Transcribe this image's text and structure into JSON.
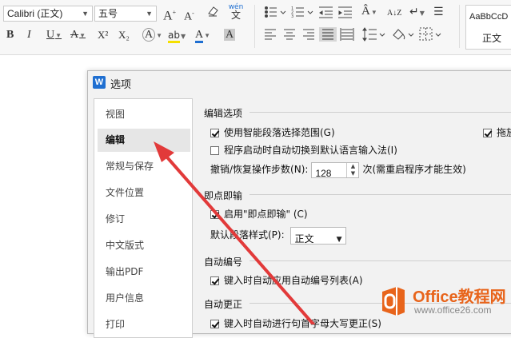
{
  "ribbon": {
    "font_name": "Calibri (正文)",
    "font_size": "五号",
    "style_sample": "AaBbCcD",
    "style_name": "正文",
    "grow_font_glyph": "A",
    "shrink_font_glyph": "A",
    "pinyin_glyph": "wén",
    "bold_glyph": "B",
    "italic_glyph": "I",
    "underline_glyph": "U",
    "strike_glyph": "A",
    "superscript_glyph": "X²",
    "subscript_glyph": "X₂",
    "text_effect_glyph": "A",
    "highlight_glyph": "ab",
    "font_color_glyph": "A",
    "char_shading_glyph": "A",
    "accent_color": "#1f6fd1"
  },
  "dialog": {
    "title": "选项",
    "app_icon_letter": "W",
    "nav_items": [
      {
        "label": "视图"
      },
      {
        "label": "编辑"
      },
      {
        "label": "常规与保存"
      },
      {
        "label": "文件位置"
      },
      {
        "label": "修订"
      },
      {
        "label": "中文版式"
      },
      {
        "label": "输出PDF"
      },
      {
        "label": "用户信息"
      },
      {
        "label": "打印"
      }
    ],
    "active_nav": "编辑",
    "sections": {
      "edit_options": {
        "title": "编辑选项",
        "smart_paragraph": {
          "label": "使用智能段落选择范围(G)",
          "checked": true
        },
        "drag_text": {
          "label": "拖放",
          "checked": true
        },
        "auto_ime": {
          "label": "程序启动时自动切换到默认语言输入法(I)",
          "checked": false
        },
        "undo_label": "撤销/恢复操作步数(N):",
        "undo_value": "128",
        "undo_suffix": "次(需重启程序才能生效)"
      },
      "click_and_type": {
        "title": "即点即输",
        "enable": {
          "label": "启用\"即点即输\" (C)",
          "checked": true
        },
        "default_style_label": "默认段落样式(P):",
        "default_style_value": "正文"
      },
      "auto_numbering": {
        "title": "自动编号",
        "apply_list": {
          "label": "键入时自动应用自动编号列表(A)",
          "checked": true
        }
      },
      "auto_correct": {
        "title": "自动更正",
        "capitalize": {
          "label": "键入时自动进行句首字母大写更正(S)",
          "checked": true
        }
      }
    }
  },
  "watermark": {
    "brand": "Office教程网",
    "url": "www.office26.com"
  }
}
